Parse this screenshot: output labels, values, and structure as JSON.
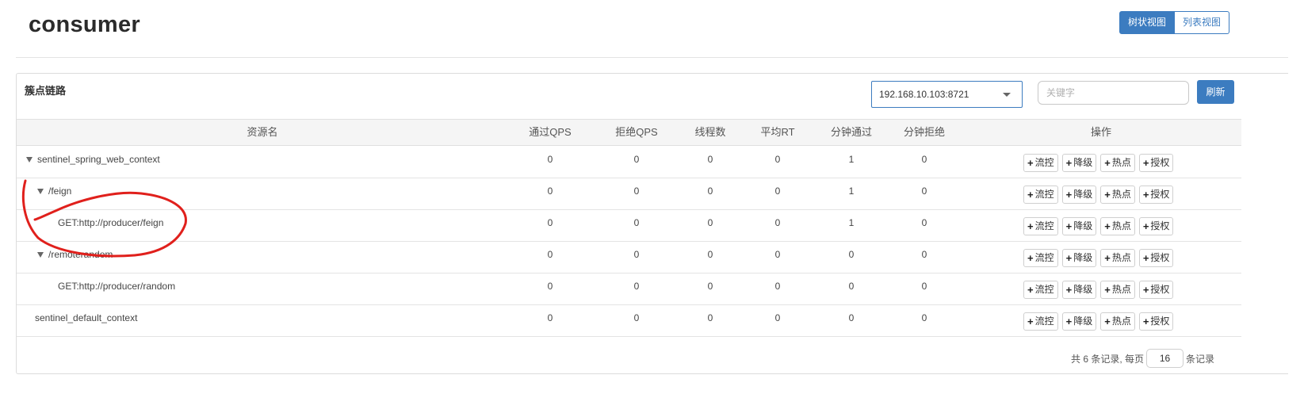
{
  "page": {
    "title": "consumer"
  },
  "view_toggle": {
    "tree": "树状视图",
    "list": "列表视图"
  },
  "panel": {
    "title": "簇点链路",
    "machine_select": {
      "value": "192.168.10.103:8721"
    },
    "search": {
      "placeholder": "关键字",
      "value": ""
    },
    "refresh_label": "刷新"
  },
  "table": {
    "headers": [
      "资源名",
      "通过QPS",
      "拒绝QPS",
      "线程数",
      "平均RT",
      "分钟通过",
      "分钟拒绝",
      "操作"
    ],
    "rows": [
      {
        "name": "sentinel_spring_web_context",
        "expanded": true,
        "values": [
          "0",
          "0",
          "0",
          "0",
          "1",
          "0"
        ]
      },
      {
        "name": "/feign",
        "expanded": true,
        "values": [
          "0",
          "0",
          "0",
          "0",
          "1",
          "0"
        ]
      },
      {
        "name": "GET:http://producer/feign",
        "expanded": false,
        "values": [
          "0",
          "0",
          "0",
          "0",
          "1",
          "0"
        ]
      },
      {
        "name": "/remoterandom",
        "expanded": true,
        "values": [
          "0",
          "0",
          "0",
          "0",
          "0",
          "0"
        ]
      },
      {
        "name": "GET:http://producer/random",
        "expanded": false,
        "values": [
          "0",
          "0",
          "0",
          "0",
          "0",
          "0"
        ]
      },
      {
        "name": "sentinel_default_context",
        "expanded": false,
        "values": [
          "0",
          "0",
          "0",
          "0",
          "0",
          "0"
        ]
      }
    ],
    "actions": [
      "流控",
      "降级",
      "热点",
      "授权"
    ]
  },
  "pager": {
    "prefix": "共 6 条记录, 每页",
    "page_size": "16",
    "suffix": "条记录"
  },
  "colors": {
    "primary": "#3c7cc0",
    "annotation": "#e0201c"
  }
}
